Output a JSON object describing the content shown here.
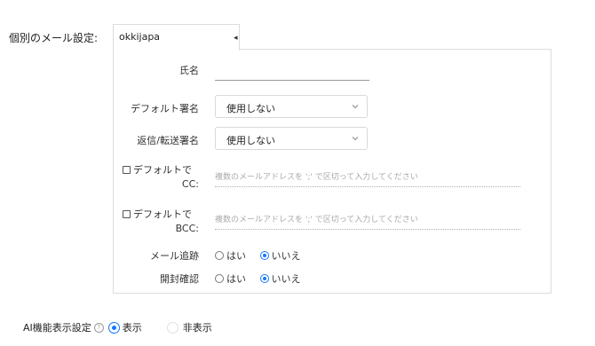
{
  "section_label": "個別のメール設定:",
  "account_tab": {
    "value": "okkijapa"
  },
  "form": {
    "name": {
      "label": "氏名",
      "value": ""
    },
    "default_signature": {
      "label": "デフォルト署名",
      "value": "使用しない"
    },
    "reply_forward_signature": {
      "label": "返信/転送署名",
      "value": "使用しない"
    },
    "default_cc": {
      "label_line1": "デフォルトで",
      "label_line2": "CC:",
      "placeholder": "複数のメールアドレスを ';' で区切って入力してください",
      "checked": false
    },
    "default_bcc": {
      "label_line1": "デフォルトで",
      "label_line2": "BCC:",
      "placeholder": "複数のメールアドレスを ';' で区切って入力してください",
      "checked": false
    },
    "mail_tracking": {
      "label": "メール追跡",
      "options": [
        "はい",
        "いいえ"
      ],
      "selected": "いいえ"
    },
    "open_confirmation": {
      "label": "開封確認",
      "options": [
        "はい",
        "いいえ"
      ],
      "selected": "いいえ"
    }
  },
  "ai_display": {
    "label": "AI機能表示設定",
    "options": [
      "表示",
      "非表示"
    ],
    "selected": "表示"
  },
  "colors": {
    "accent": "#1677ff",
    "border": "#dcdcdc"
  }
}
